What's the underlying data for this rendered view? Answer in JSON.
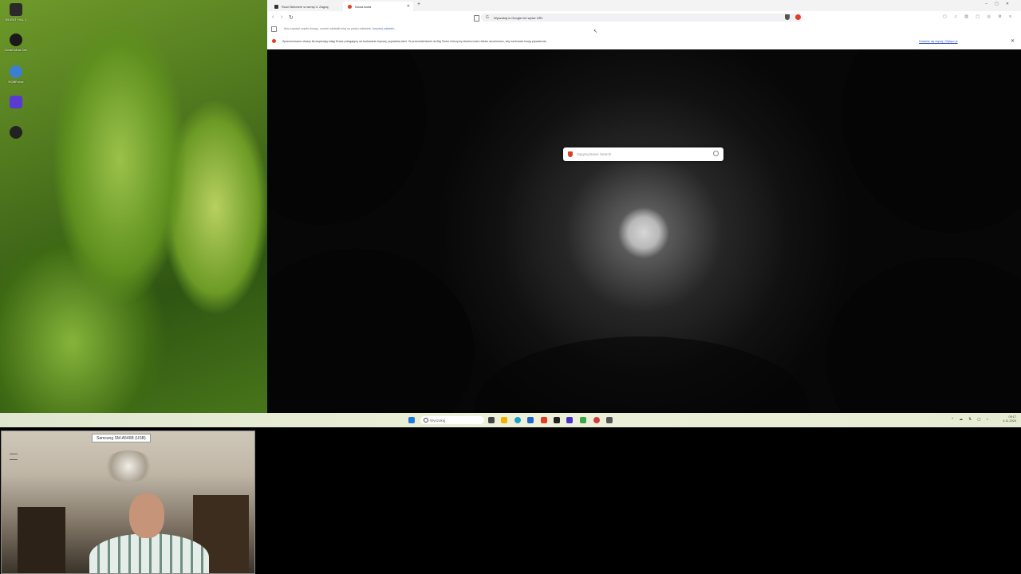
{
  "desktop": {
    "icons": [
      {
        "label": "SILENT HILL 2",
        "color": "#2a2a2a"
      },
      {
        "label": "Death Must Die",
        "color": "#1a1a1a"
      },
      {
        "label": "ROBR.exe",
        "color": "#3c7fd0"
      },
      {
        "label": "",
        "color": "#5a3ad0"
      },
      {
        "label": "",
        "color": "#222222"
      }
    ]
  },
  "browser": {
    "tabs": [
      {
        "title": "Rzuć Betonem w wersji 4: Zagraj",
        "active": false
      },
      {
        "title": "Nowa karta",
        "active": true
      }
    ],
    "url_text": "Wyszukaj w Google lub wpisz URL",
    "bookmarks_text": "Aby uzyskać szybki dostęp, umieść zakładki tutaj na pasku zakładek.",
    "bookmarks_link": "Importuj zakładki...",
    "notice_text": "Sponsorowane obrazy tła wspierają misję Brave polegającą na budowaniu lepszej, prywatnej sieci. W przeciwieństwie do Big Techu mierzymy skuteczność reklam anonimowo, aby zachować twoją prywatność.",
    "notice_link": "Dowiedz się więcej | Wyłącz je",
    "search_placeholder": "Zapytaj Brave Search"
  },
  "taskbar": {
    "search_placeholder": "Wyszukaj",
    "clock_time": "09:17",
    "clock_date": "4.11.2024"
  },
  "webcam": {
    "device_label": "Samsung SM-A546B (USB)"
  }
}
